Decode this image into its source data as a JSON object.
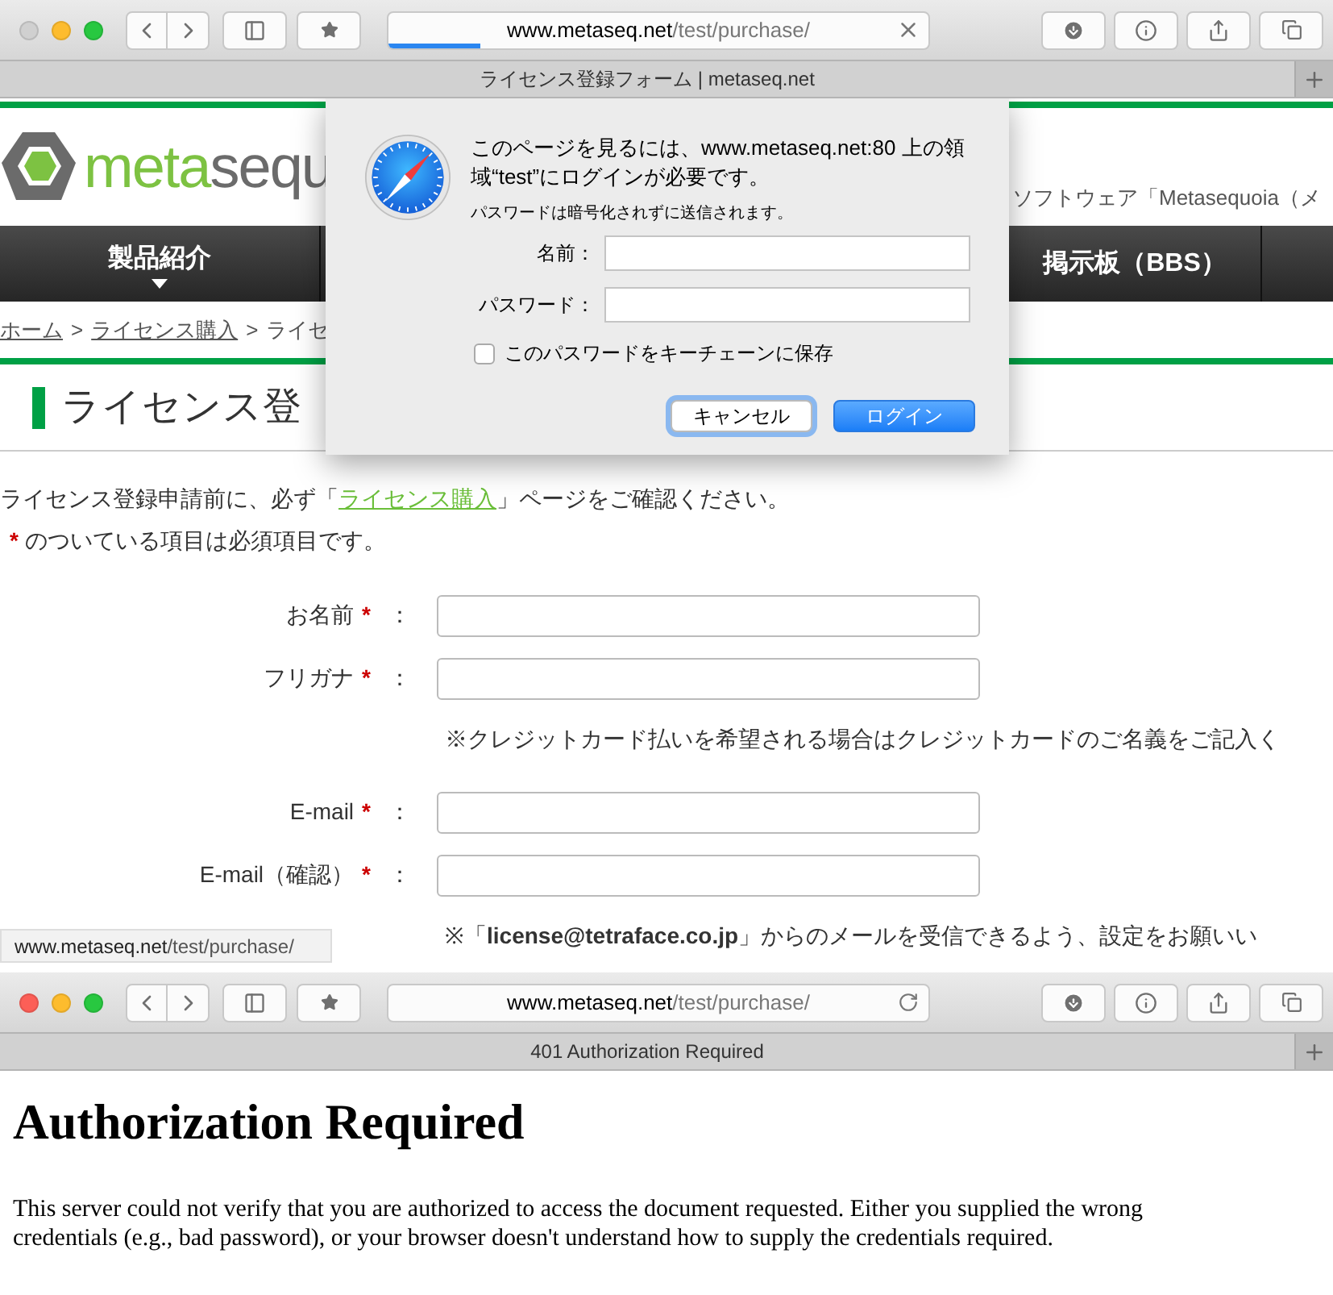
{
  "windows": [
    {
      "kind": "form",
      "active": false,
      "address": {
        "host": "www.metaseq.net",
        "path": "/test/purchase/"
      },
      "loading": true,
      "level": 0.17,
      "tab_title": "ライセンス登録フォーム | metaseq.net",
      "site": {
        "logo": {
          "green": "meta",
          "grey": "sequ"
        },
        "tagline": "ソフトウェア「Metasequoia（メ",
        "nav": [
          {
            "label": "製品紹介",
            "dropdown": true
          },
          {
            "label": "掲示板（BBS）",
            "dropdown": false
          }
        ],
        "breadcrumb_separator": ">",
        "breadcrumb": [
          {
            "label": "ホーム",
            "link": true
          },
          {
            "label": "ライセンス購入",
            "link": true
          },
          {
            "label": "ライセ",
            "link": false
          }
        ],
        "heading": "ライセンス登",
        "intro": {
          "before": "ライセンス登録申請前に、必ず「",
          "link": "ライセンス購入",
          "after": "」ページをご確認ください。"
        },
        "required_note": {
          "mark": "*",
          "text": "のついている項目は必須項目です。"
        },
        "form": [
          {
            "kind": "field",
            "label": "お名前",
            "required": true,
            "separator": "："
          },
          {
            "kind": "field",
            "label": "フリガナ",
            "required": true,
            "separator": "："
          },
          {
            "kind": "note",
            "text": "※クレジットカード払いを希望される場合はクレジットカードのご名義をご記入く"
          },
          {
            "kind": "field",
            "label": "E-mail",
            "required": true,
            "separator": "："
          },
          {
            "kind": "field",
            "label": "E-mail（確認）",
            "required": true,
            "separator": "："
          },
          {
            "kind": "note",
            "text": "※「**license@tetraface.co.jp**」からのメールを受信できるよう、設定をお願いい"
          }
        ],
        "status_url": {
          "host": "www.metaseq.net",
          "path": "/test/purchase/"
        }
      },
      "dialog": {
        "message": "このページを見るには、www.metaseq.net:80 上の領域“test”にログインが必要です。",
        "notice": "パスワードは暗号化されずに送信されます。",
        "fields": [
          {
            "label": "名前："
          },
          {
            "label": "パスワード："
          }
        ],
        "keychain": {
          "label": "このパスワードをキーチェーンに保存",
          "checked": false
        },
        "buttons": [
          {
            "label": "キャンセル",
            "kind": "cancel"
          },
          {
            "label": "ログイン",
            "kind": "default"
          }
        ]
      }
    },
    {
      "kind": "error",
      "active": true,
      "address": {
        "host": "www.metaseq.net",
        "path": "/test/purchase/"
      },
      "loading": false,
      "tab_title": "401 Authorization Required",
      "heading": "Authorization Required",
      "paragraph": "This server could not verify that you are authorized to access the document requested. Either you supplied the wrong credentials (e.g., bad password), or your browser doesn't understand how to supply the credentials required."
    }
  ]
}
